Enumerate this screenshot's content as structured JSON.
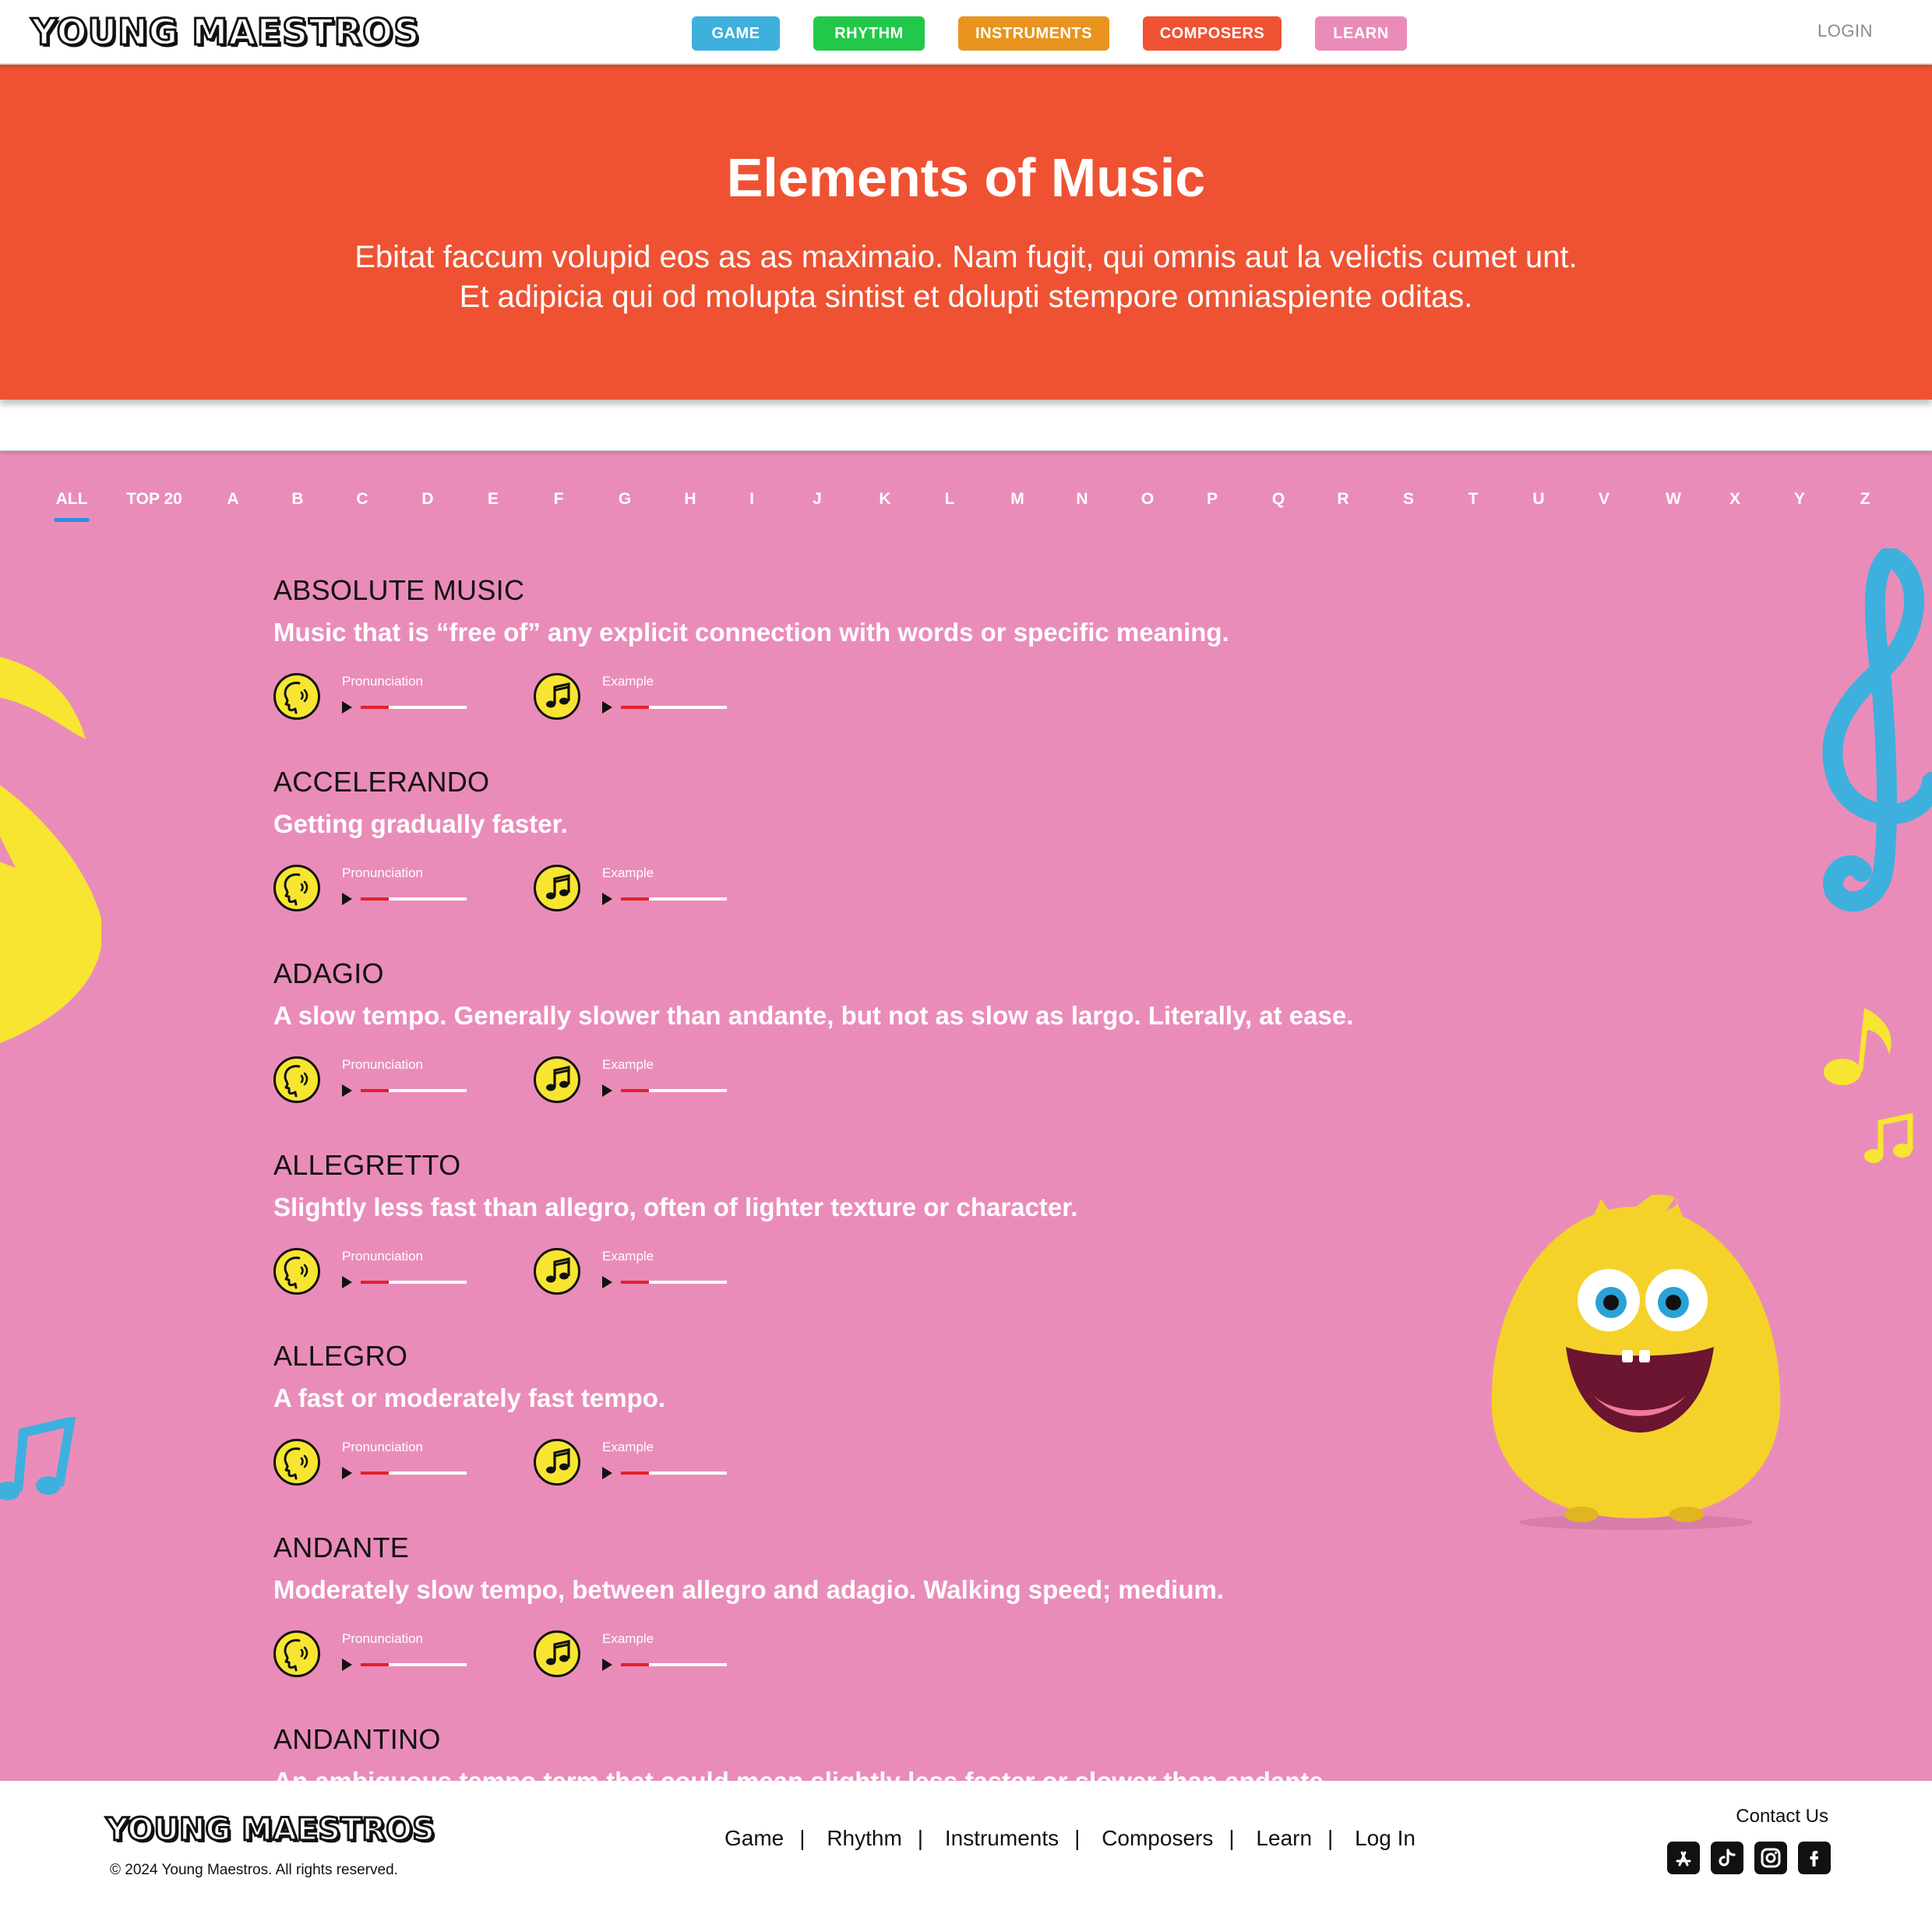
{
  "header": {
    "logo": "YOUNG MAESTROS",
    "nav": [
      {
        "label": "GAME",
        "color": "#3eb0dd"
      },
      {
        "label": "RHYTHM",
        "color": "#22c84a"
      },
      {
        "label": "INSTRUMENTS",
        "color": "#e8941f"
      },
      {
        "label": "COMPOSERS",
        "color": "#ef5232"
      },
      {
        "label": "LEARN",
        "color": "#ea8cb9"
      }
    ],
    "login": "LOGIN"
  },
  "hero": {
    "title": "Elements of Music",
    "line1": "Ebitat faccum volupid eos as as maximaio. Nam fugit, qui omnis aut la velictis cumet unt.",
    "line2": "Et adipicia qui od molupta sintist et dolupti stempore omniaspiente oditas."
  },
  "filters": {
    "active": "ALL",
    "items": [
      "ALL",
      "TOP 20",
      "A",
      "B",
      "C",
      "D",
      "E",
      "F",
      "G",
      "H",
      "I",
      "J",
      "K",
      "L",
      "M",
      "N",
      "O",
      "P",
      "Q",
      "R",
      "S",
      "T",
      "U",
      "V",
      "W",
      "X",
      "Y",
      "Z"
    ]
  },
  "player_labels": {
    "pronunciation": "Pronunciation",
    "example": "Example"
  },
  "terms": [
    {
      "title": "ABSOLUTE MUSIC",
      "definition": "Music that is “free of” any explicit connection with words or specific meaning."
    },
    {
      "title": "ACCELERANDO",
      "definition": "Getting gradually faster."
    },
    {
      "title": "ADAGIO",
      "definition": "A slow tempo. Generally slower than andante, but not as slow as largo. Literally, at ease."
    },
    {
      "title": "ALLEGRETTO",
      "definition": "Slightly less fast than allegro, often of lighter texture or character."
    },
    {
      "title": "ALLEGRO",
      "definition": "A fast or moderately fast tempo."
    },
    {
      "title": "ANDANTE",
      "definition": "Moderately slow tempo, between allegro and adagio. Walking speed; medium."
    },
    {
      "title": "ANDANTINO",
      "definition": "An ambiguous tempo term that could mean slightly less faster or slower than andante."
    }
  ],
  "footer": {
    "logo": "YOUNG MAESTROS",
    "copyright": "© 2024 Young Maestros. All rights reserved.",
    "links": [
      "Game",
      "Rhythm",
      "Instruments",
      "Composers",
      "Learn",
      "Log In"
    ],
    "contact": "Contact Us",
    "social": [
      "app-store-icon",
      "tiktok-icon",
      "instagram-icon",
      "facebook-icon"
    ]
  },
  "colors": {
    "hero": "#ef5232",
    "main": "#ea8cb9",
    "accent_yellow": "#f7e531",
    "accent_blue": "#3eb0dd"
  }
}
